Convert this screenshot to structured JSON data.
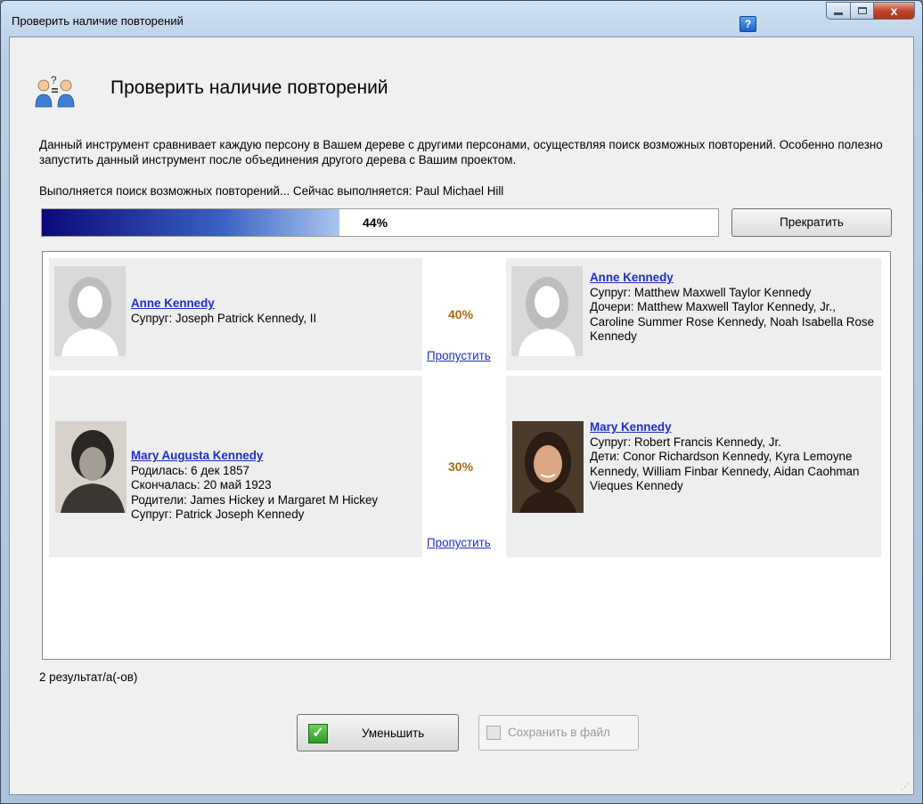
{
  "window": {
    "title": "Проверить наличие повторений",
    "help": "?",
    "close_glyph": "x"
  },
  "header": {
    "title": "Проверить наличие повторений",
    "icon": "two-people-question-icon"
  },
  "description": "Данный инструмент сравнивает каждую персону в Вашем дереве с другими персонами, осуществляя поиск возможных повторений. Особенно полезно запустить данный инструмент после объединения другого дерева с Вашим проектом.",
  "status": "Выполняется поиск возможных повторений... Сейчас выполняется: Paul Michael Hill",
  "progress": {
    "value": 0.44,
    "label": "44%"
  },
  "stop_button": "Прекратить",
  "results": [
    {
      "left": {
        "name": "Anne Kennedy",
        "lines": [
          "Супруг: Joseph Patrick Kennedy, II"
        ],
        "photo": "female-silhouette"
      },
      "match": "40%",
      "skip": "Пропустить",
      "right": {
        "name": "Anne Kennedy",
        "lines": [
          "Супруг: Matthew Maxwell Taylor Kennedy",
          "Дочери: Matthew Maxwell Taylor Kennedy, Jr., Caroline Summer Rose Kennedy, Noah Isabella Rose Kennedy"
        ],
        "photo": "female-silhouette"
      }
    },
    {
      "left": {
        "name": "Mary Augusta Kennedy",
        "lines": [
          "Родилась: 6 дек 1857",
          "Скончалась: 20 май 1923",
          "Родители: James Hickey и Margaret M Hickey",
          "Супруг: Patrick Joseph Kennedy"
        ],
        "photo": "vintage-portrait"
      },
      "match": "30%",
      "skip": "Пропустить",
      "right": {
        "name": "Mary Kennedy",
        "lines": [
          "Супруг: Robert Francis Kennedy, Jr.",
          "Дети: Conor Richardson Kennedy, Kyra Lemoyne Kennedy, William Finbar Kennedy, Aidan Caohman Vieques Kennedy"
        ],
        "photo": "color-portrait"
      }
    }
  ],
  "result_count": "2 результат/а(-ов)",
  "reduce_button": "Уменьшить",
  "save_button": "Сохранить в файл"
}
